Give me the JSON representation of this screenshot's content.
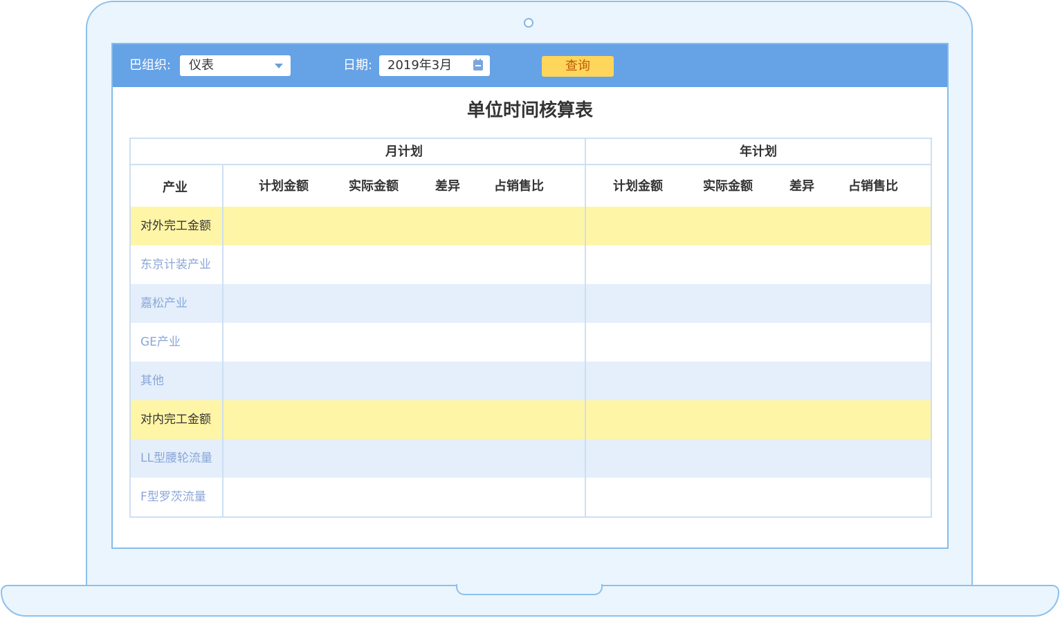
{
  "toolbar": {
    "org_label": "巴组织:",
    "org_value": "仪表",
    "date_label": "日期:",
    "date_value": "2019年3月",
    "query_label": "查询"
  },
  "report": {
    "title": "单位时间核算表",
    "group_month": "月计划",
    "group_year": "年计划",
    "industry_header": "产业",
    "month_columns": [
      "计划金额",
      "实际金额",
      "差异",
      "占销售比"
    ],
    "year_columns": [
      "计划金额",
      "实际金额",
      "差异",
      "占销售比"
    ],
    "rows": [
      {
        "label": "对外完工金额",
        "style": "yellow"
      },
      {
        "label": "东京计装产业",
        "style": "white"
      },
      {
        "label": "嘉松产业",
        "style": "blue"
      },
      {
        "label": "GE产业",
        "style": "white"
      },
      {
        "label": "其他",
        "style": "blue"
      },
      {
        "label": "对内完工金额",
        "style": "yellow"
      },
      {
        "label": "LL型腰轮流量",
        "style": "blue"
      },
      {
        "label": "F型罗茨流量",
        "style": "white"
      }
    ]
  },
  "colors": {
    "toolbar_bg": "#66a2e6",
    "query_button_bg": "#ffd65c",
    "highlight_row": "#fff5a6",
    "stripe_row": "#e4effb"
  }
}
